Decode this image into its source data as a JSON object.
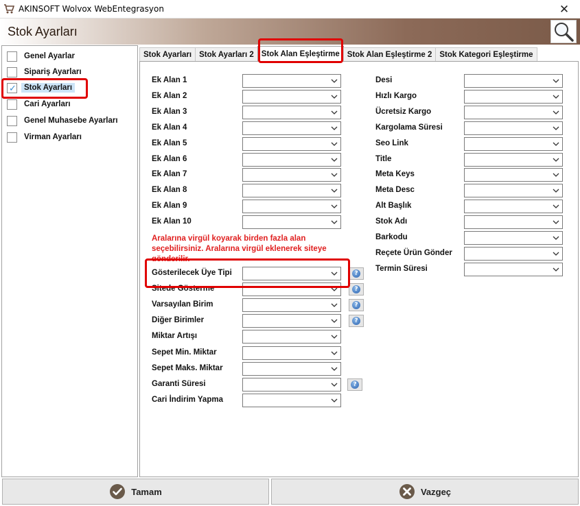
{
  "window": {
    "title": "AKINSOFT Wolvox WebEntegrasyon",
    "close_glyph": "✕"
  },
  "header": {
    "title": "Stok Ayarları",
    "search_icon": "magnifier-icon"
  },
  "sidebar": {
    "items": [
      {
        "label": "Genel Ayarlar",
        "checked": false
      },
      {
        "label": "Sipariş Ayarları",
        "checked": false
      },
      {
        "label": "Stok Ayarları",
        "checked": true
      },
      {
        "label": "Cari Ayarları",
        "checked": false
      },
      {
        "label": "Genel Muhasebe Ayarları",
        "checked": false
      },
      {
        "label": "Virman Ayarları",
        "checked": false
      }
    ]
  },
  "tabs": [
    {
      "label": "Stok Ayarları"
    },
    {
      "label": "Stok Ayarları 2"
    },
    {
      "label": "Stok Alan Eşleştirme",
      "active": true
    },
    {
      "label": "Stok Alan Eşleştirme 2"
    },
    {
      "label": "Stok Kategori Eşleştirme"
    }
  ],
  "left_fields": [
    {
      "label": "Ek Alan 1",
      "value": ""
    },
    {
      "label": "Ek Alan 2",
      "value": ""
    },
    {
      "label": "Ek Alan 3",
      "value": ""
    },
    {
      "label": "Ek Alan 4",
      "value": ""
    },
    {
      "label": "Ek Alan 5",
      "value": ""
    },
    {
      "label": "Ek Alan 6",
      "value": ""
    },
    {
      "label": "Ek Alan 7",
      "value": ""
    },
    {
      "label": "Ek Alan 8",
      "value": ""
    },
    {
      "label": "Ek Alan 9",
      "value": ""
    },
    {
      "label": "Ek Alan 10",
      "value": ""
    }
  ],
  "note": "Aralarına virgül koyarak birden fazla alan seçebilirsiniz. Aralarına virgül  eklenerek siteye gönderilir.",
  "lower_fields": [
    {
      "label": "Gösterilecek Üye Tipi",
      "value": "",
      "help": true
    },
    {
      "label": "Sitede Gösterme",
      "value": "",
      "help": true
    },
    {
      "label": "Varsayılan Birim",
      "value": "",
      "help": true
    },
    {
      "label": "Diğer Birimler",
      "value": "",
      "help": true
    },
    {
      "label": "Miktar Artışı",
      "value": "",
      "help": false
    },
    {
      "label": "Sepet Min. Miktar",
      "value": "",
      "help": false
    },
    {
      "label": "Sepet Maks. Miktar",
      "value": "",
      "help": false
    },
    {
      "label": "Garanti Süresi",
      "value": "",
      "help": true
    },
    {
      "label": "Cari İndirim Yapma",
      "value": "",
      "help": false
    }
  ],
  "right_fields": [
    {
      "label": "Desi",
      "value": ""
    },
    {
      "label": "Hızlı Kargo",
      "value": ""
    },
    {
      "label": "Ücretsiz Kargo",
      "value": ""
    },
    {
      "label": "Kargolama Süresi",
      "value": ""
    },
    {
      "label": "Seo Link",
      "value": ""
    },
    {
      "label": "Title",
      "value": ""
    },
    {
      "label": "Meta Keys",
      "value": ""
    },
    {
      "label": "Meta Desc",
      "value": ""
    },
    {
      "label": "Alt Başlık",
      "value": ""
    },
    {
      "label": "Stok Adı",
      "value": ""
    },
    {
      "label": "Barkodu",
      "value": ""
    },
    {
      "label": "Reçete Ürün Gönder",
      "value": ""
    },
    {
      "label": "Termin Süresi",
      "value": ""
    }
  ],
  "footer": {
    "ok_label": "Tamam",
    "cancel_label": "Vazgeç"
  },
  "colors": {
    "highlight": "#e00000",
    "note_text": "#e02020",
    "selection": "#cce4f7",
    "ok_icon": "#6a5a4a",
    "cancel_icon": "#6a5a4a"
  }
}
